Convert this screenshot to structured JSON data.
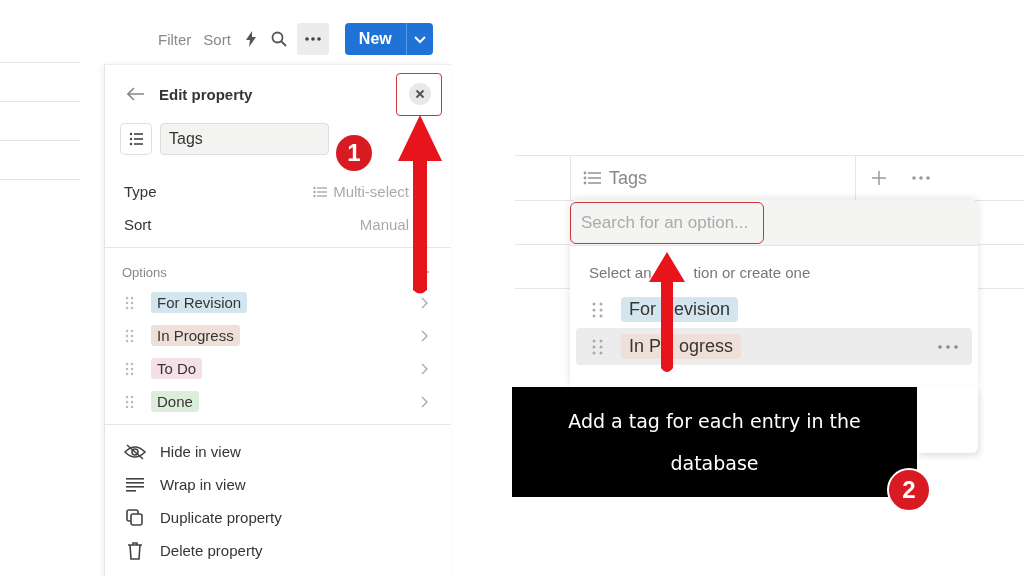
{
  "toolbar": {
    "filter": "Filter",
    "sort": "Sort",
    "new_button": "New"
  },
  "edit_property": {
    "title": "Edit property",
    "name_value": "Tags",
    "type_label": "Type",
    "type_value": "Multi-select",
    "sort_label": "Sort",
    "sort_value": "Manual",
    "options_label": "Options",
    "options": [
      {
        "label": "For Revision",
        "color": "#d3e5ef"
      },
      {
        "label": "In Progress",
        "color": "#eedfd9"
      },
      {
        "label": "To Do",
        "color": "#f5e0e9"
      },
      {
        "label": "Done",
        "color": "#dbeddb"
      }
    ],
    "actions": [
      {
        "kind": "hide",
        "label": "Hide in view"
      },
      {
        "kind": "wrap",
        "label": "Wrap in view"
      },
      {
        "kind": "duplicate",
        "label": "Duplicate property"
      },
      {
        "kind": "delete",
        "label": "Delete property"
      }
    ]
  },
  "table": {
    "column_header": "Tags"
  },
  "dropdown": {
    "placeholder": "Search for an option...",
    "hint": [
      "Select an",
      "tion or create one"
    ],
    "options": [
      {
        "label": [
          "For",
          "evision"
        ],
        "color": "#d3e5ef",
        "selected": false
      },
      {
        "label": [
          "In P",
          "ogress"
        ],
        "color": "#eedfd9",
        "selected": true
      }
    ]
  },
  "caption": "Add a tag for each entry in the database",
  "steps": [
    "1",
    "2"
  ]
}
